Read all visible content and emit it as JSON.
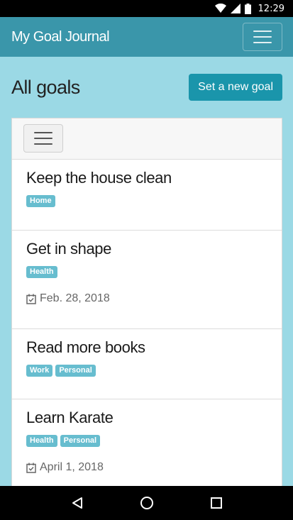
{
  "status": {
    "time": "12:29"
  },
  "app": {
    "brand": "My Goal Journal"
  },
  "page": {
    "title": "All goals",
    "new_goal_label": "Set a new goal"
  },
  "goals": [
    {
      "title": "Keep the house clean",
      "tags": [
        "Home"
      ],
      "due": ""
    },
    {
      "title": "Get in shape",
      "tags": [
        "Health"
      ],
      "due": "Feb. 28, 2018"
    },
    {
      "title": "Read more books",
      "tags": [
        "Work",
        "Personal"
      ],
      "due": ""
    },
    {
      "title": "Learn Karate",
      "tags": [
        "Health",
        "Personal"
      ],
      "due": "April 1, 2018"
    }
  ],
  "colors": {
    "appbar": "#3a96aa",
    "background": "#9bd9e5",
    "accent": "#1a95ab",
    "tag": "#67bdcf"
  },
  "icons": {
    "wifi": "wifi-icon",
    "signal": "signal-icon",
    "battery": "battery-icon",
    "calendar": "calendar-check-icon",
    "back": "back-icon",
    "home": "home-icon",
    "recents": "recents-icon"
  }
}
